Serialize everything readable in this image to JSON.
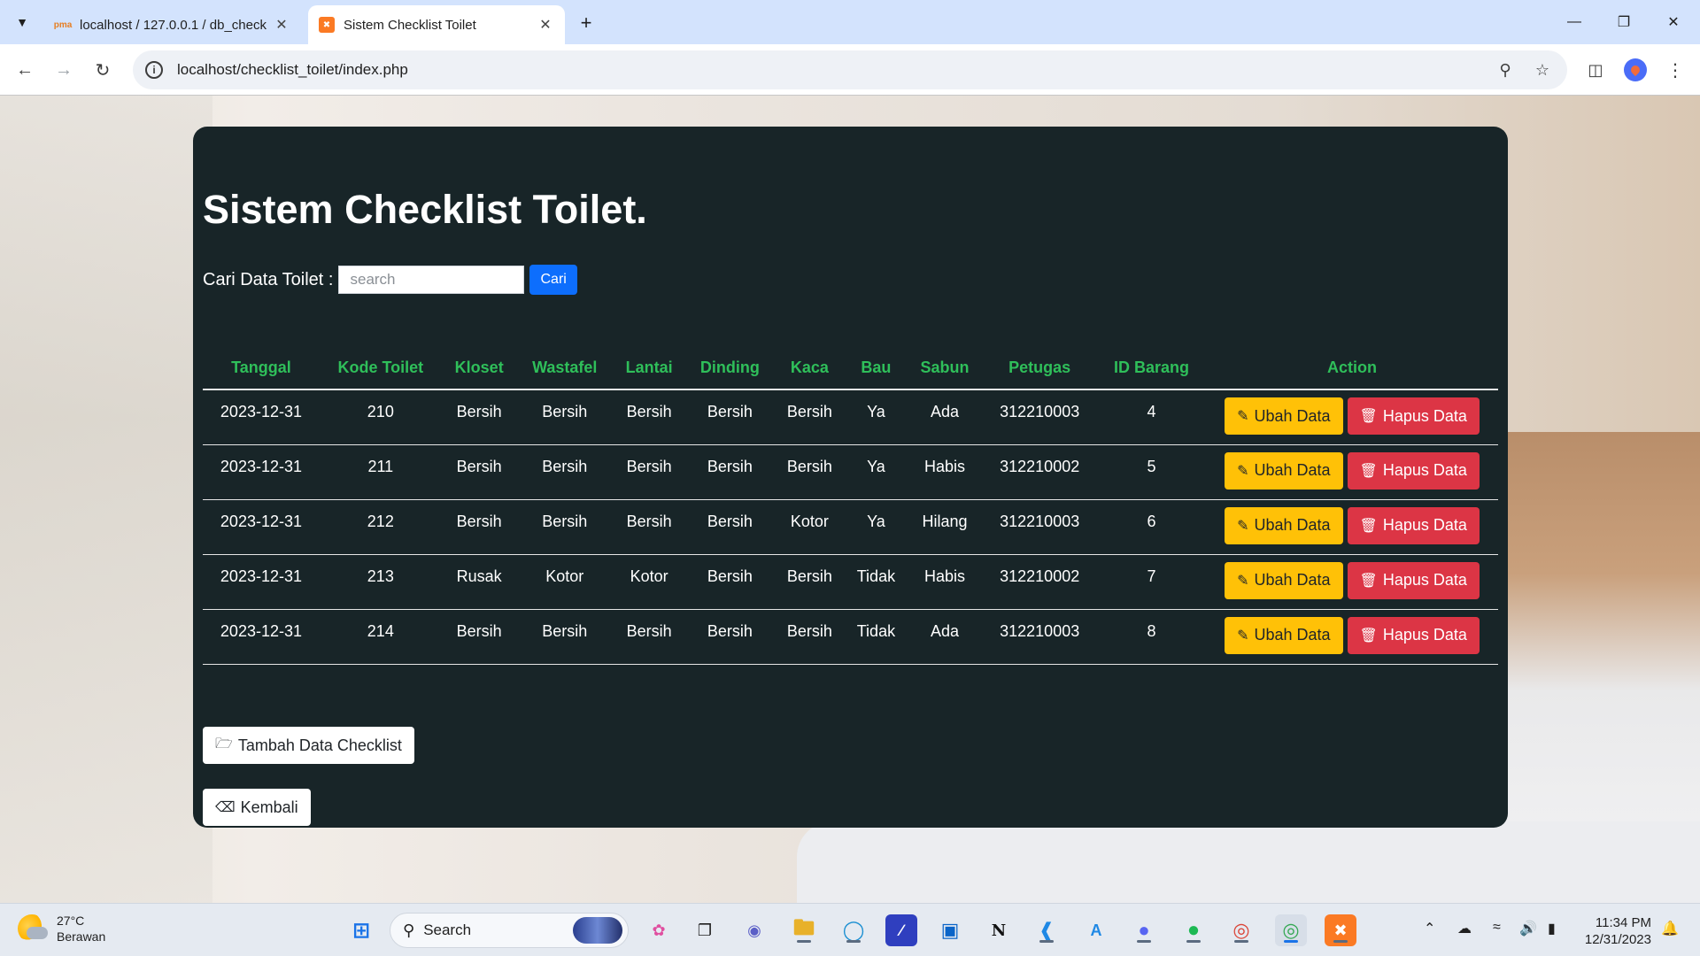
{
  "browser": {
    "tabs": [
      {
        "title": "localhost / 127.0.0.1 / db_check"
      },
      {
        "title": "Sistem Checklist Toilet"
      }
    ],
    "url": "localhost/checklist_toilet/index.php"
  },
  "page": {
    "title": "Sistem Checklist Toilet.",
    "search_label": "Cari Data Toilet :",
    "search_placeholder": "search",
    "search_button": "Cari",
    "columns": [
      "Tanggal",
      "Kode Toilet",
      "Kloset",
      "Wastafel",
      "Lantai",
      "Dinding",
      "Kaca",
      "Bau",
      "Sabun",
      "Petugas",
      "ID Barang",
      "Action"
    ],
    "rows": [
      {
        "tanggal": "2023-12-31",
        "kode": "210",
        "kloset": "Bersih",
        "wastafel": "Bersih",
        "lantai": "Bersih",
        "dinding": "Bersih",
        "kaca": "Bersih",
        "bau": "Ya",
        "sabun": "Ada",
        "petugas": "312210003",
        "id_barang": "4"
      },
      {
        "tanggal": "2023-12-31",
        "kode": "211",
        "kloset": "Bersih",
        "wastafel": "Bersih",
        "lantai": "Bersih",
        "dinding": "Bersih",
        "kaca": "Bersih",
        "bau": "Ya",
        "sabun": "Habis",
        "petugas": "312210002",
        "id_barang": "5"
      },
      {
        "tanggal": "2023-12-31",
        "kode": "212",
        "kloset": "Bersih",
        "wastafel": "Bersih",
        "lantai": "Bersih",
        "dinding": "Bersih",
        "kaca": "Kotor",
        "bau": "Ya",
        "sabun": "Hilang",
        "petugas": "312210003",
        "id_barang": "6"
      },
      {
        "tanggal": "2023-12-31",
        "kode": "213",
        "kloset": "Rusak",
        "wastafel": "Kotor",
        "lantai": "Kotor",
        "dinding": "Bersih",
        "kaca": "Bersih",
        "bau": "Tidak",
        "sabun": "Habis",
        "petugas": "312210002",
        "id_barang": "7"
      },
      {
        "tanggal": "2023-12-31",
        "kode": "214",
        "kloset": "Bersih",
        "wastafel": "Bersih",
        "lantai": "Bersih",
        "dinding": "Bersih",
        "kaca": "Bersih",
        "bau": "Tidak",
        "sabun": "Ada",
        "petugas": "312210003",
        "id_barang": "8"
      }
    ],
    "edit_label": "Ubah Data",
    "delete_label": "Hapus Data",
    "add_label": "Tambah Data Checklist",
    "back_label": "Kembali"
  },
  "taskbar": {
    "weather_temp": "27°C",
    "weather_desc": "Berawan",
    "search_label": "Search",
    "time": "11:34 PM",
    "date": "12/31/2023"
  },
  "colors": {
    "card_bg": "#182528",
    "header_green": "#2fbf5a",
    "primary": "#0d6efd",
    "warning": "#ffc107",
    "danger": "#dc3545"
  }
}
